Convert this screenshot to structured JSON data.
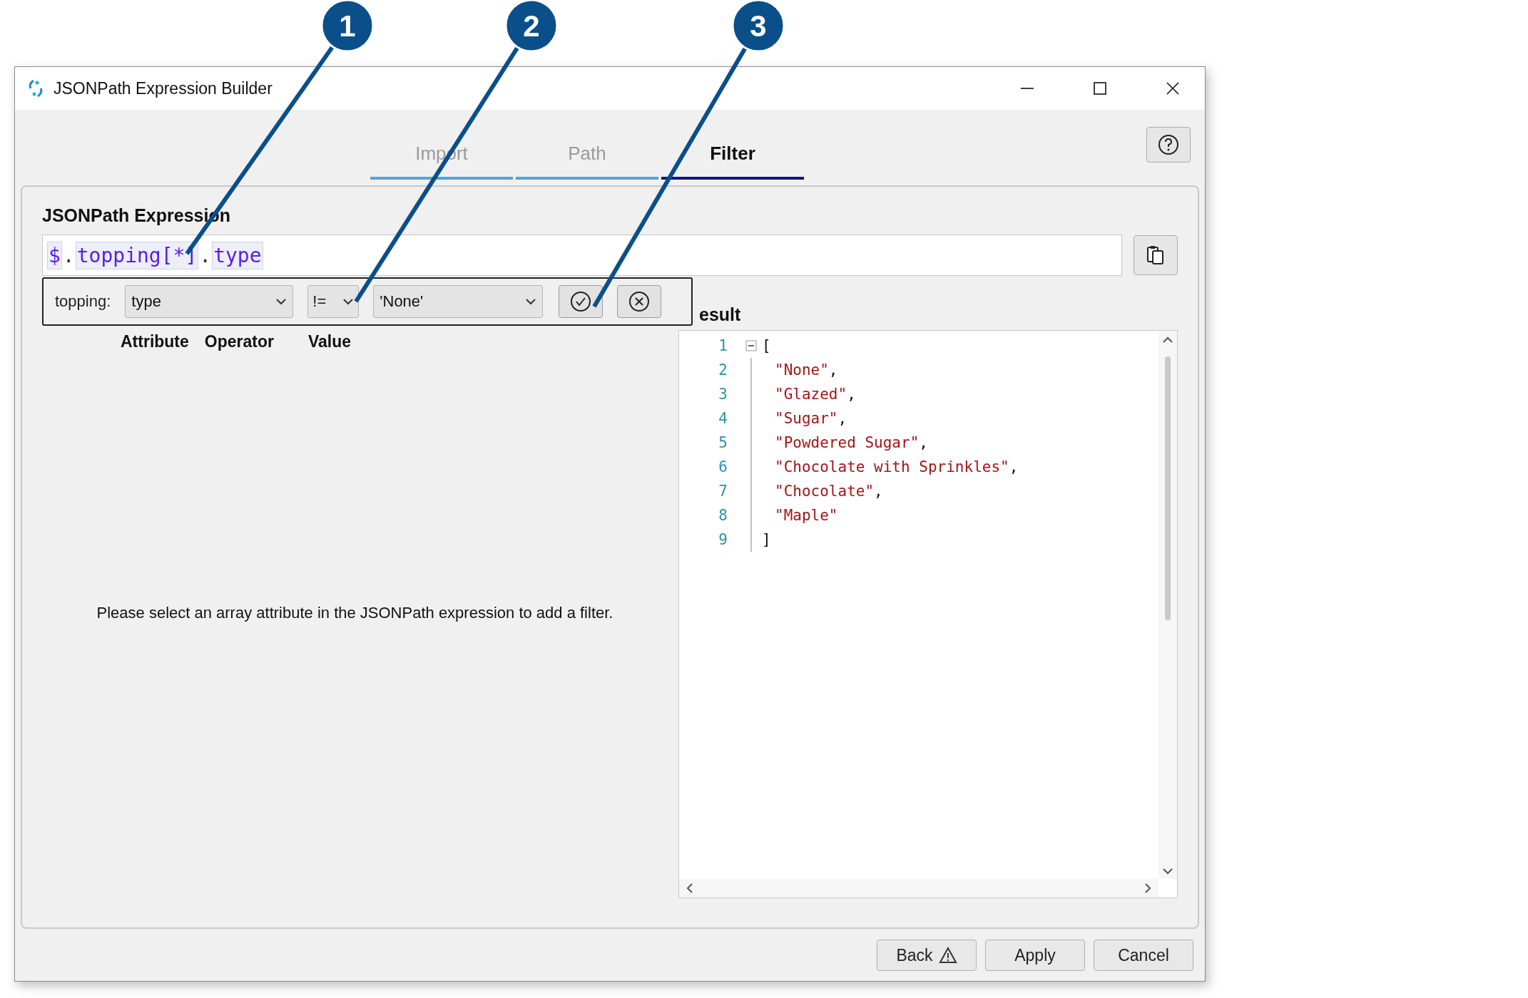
{
  "window": {
    "title": "JSONPath Expression Builder"
  },
  "tabs": [
    {
      "label": "Import",
      "selected": false
    },
    {
      "label": "Path",
      "selected": false
    },
    {
      "label": "Filter",
      "selected": true
    }
  ],
  "expression": {
    "label": "JSONPath Expression",
    "tokens": [
      {
        "text": "$",
        "highlighted": true
      },
      {
        "text": ".",
        "highlighted": false
      },
      {
        "text": "topping[*]",
        "highlighted": true
      },
      {
        "text": ".",
        "highlighted": false
      },
      {
        "text": "type",
        "highlighted": true
      }
    ]
  },
  "filter": {
    "array_label": "topping:",
    "attribute": "type",
    "operator": "!=",
    "value": "'None'",
    "columns": [
      "Attribute",
      "Operator",
      "Value"
    ]
  },
  "message": "Please select an array attribute in the JSONPath expression to add a filter.",
  "result": {
    "label": "esult",
    "lines": [
      {
        "number": "1",
        "kind": "open",
        "text": "["
      },
      {
        "number": "2",
        "kind": "string",
        "text": "\"None\"",
        "trail": ","
      },
      {
        "number": "3",
        "kind": "string",
        "text": "\"Glazed\"",
        "trail": ","
      },
      {
        "number": "4",
        "kind": "string",
        "text": "\"Sugar\"",
        "trail": ","
      },
      {
        "number": "5",
        "kind": "string",
        "text": "\"Powdered Sugar\"",
        "trail": ","
      },
      {
        "number": "6",
        "kind": "string",
        "text": "\"Chocolate with Sprinkles\"",
        "trail": ","
      },
      {
        "number": "7",
        "kind": "string",
        "text": "\"Chocolate\"",
        "trail": ","
      },
      {
        "number": "8",
        "kind": "string",
        "text": "\"Maple\""
      },
      {
        "number": "9",
        "kind": "close",
        "text": "]"
      }
    ]
  },
  "buttons": [
    "Back",
    "Apply",
    "Cancel"
  ],
  "callouts": [
    {
      "label": "1"
    },
    {
      "label": "2"
    },
    {
      "label": "3"
    }
  ]
}
